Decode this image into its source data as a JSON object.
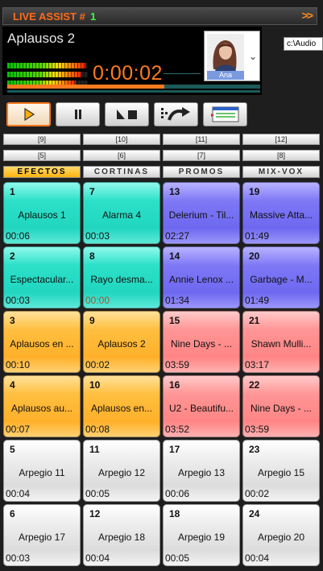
{
  "titlebar": {
    "title": "LIVE ASSIST #",
    "number": "1",
    "expand_icon": "double-chevron-right-icon",
    "title_color": "#ff6a1a",
    "number_color": "#32ff32"
  },
  "player": {
    "song_title": "Aplausos 2",
    "time": "0:00:02",
    "cover_label": "Ana",
    "path": "c:\\Audio",
    "progress_fraction": 0.62,
    "meter_levels": [
      0.97,
      0.92,
      0.85
    ],
    "accent_color": "#ff7a1f"
  },
  "transport": {
    "buttons": [
      {
        "name": "play-button",
        "icon": "play-icon"
      },
      {
        "name": "pause-button",
        "icon": "pause-icon"
      },
      {
        "name": "stop-button",
        "icon": "stop-icon"
      },
      {
        "name": "crossfade-button",
        "icon": "crossfade-icon"
      },
      {
        "name": "playlist-button",
        "icon": "playlist-icon"
      }
    ]
  },
  "tabs": {
    "row1": [
      "[9]",
      "[10]",
      "[11]",
      "[12]"
    ],
    "row2": [
      "[5]",
      "[6]",
      "[7]",
      "[8]"
    ],
    "categories": [
      "EFECTOS",
      "CORTINAS",
      "PROMOS",
      "MIX-VOX"
    ],
    "active_category": 0
  },
  "grid": [
    [
      {
        "num": "1",
        "name": "Aplausos 1",
        "time": "00:06",
        "color": "cyan"
      },
      {
        "num": "7",
        "name": "Alarma 4",
        "time": "00:03",
        "color": "cyan"
      },
      {
        "num": "13",
        "name": "Delerium - Til...",
        "time": "02:27",
        "color": "blue"
      },
      {
        "num": "19",
        "name": "Massive Atta...",
        "time": "01:49",
        "color": "blue"
      }
    ],
    [
      {
        "num": "2",
        "name": "Espectacular...",
        "time": "00:03",
        "color": "cyan"
      },
      {
        "num": "8",
        "name": "Rayo desma...",
        "time": "00:00",
        "color": "cyan",
        "time_color": "#9a5a3a"
      },
      {
        "num": "14",
        "name": "Annie Lenox ...",
        "time": "01:34",
        "color": "blue"
      },
      {
        "num": "20",
        "name": "Garbage - M...",
        "time": "01:49",
        "color": "blue"
      }
    ],
    [
      {
        "num": "3",
        "name": "Aplausos en ...",
        "time": "00:10",
        "color": "orange"
      },
      {
        "num": "9",
        "name": "Aplausos 2",
        "time": "00:02",
        "color": "orange"
      },
      {
        "num": "15",
        "name": "Nine Days - ...",
        "time": "03:59",
        "color": "red"
      },
      {
        "num": "21",
        "name": "Shawn Mulli...",
        "time": "03:17",
        "color": "red"
      }
    ],
    [
      {
        "num": "4",
        "name": "Aplausos au...",
        "time": "00:07",
        "color": "orange"
      },
      {
        "num": "10",
        "name": "Aplausos en...",
        "time": "00:08",
        "color": "orange"
      },
      {
        "num": "16",
        "name": "U2 - Beautifu...",
        "time": "03:52",
        "color": "red"
      },
      {
        "num": "22",
        "name": "Nine Days - ...",
        "time": "03:59",
        "color": "red"
      }
    ],
    [
      {
        "num": "5",
        "name": "Arpegio 11",
        "time": "00:04",
        "color": "gray"
      },
      {
        "num": "11",
        "name": "Arpegio 12",
        "time": "00:05",
        "color": "gray"
      },
      {
        "num": "17",
        "name": "Arpegio 13",
        "time": "00:06",
        "color": "gray"
      },
      {
        "num": "23",
        "name": "Arpegio 15",
        "time": "00:02",
        "color": "gray"
      }
    ],
    [
      {
        "num": "6",
        "name": "Arpegio 17",
        "time": "00:03",
        "color": "gray"
      },
      {
        "num": "12",
        "name": "Arpegio 18",
        "time": "00:04",
        "color": "gray"
      },
      {
        "num": "18",
        "name": "Arpegio 19",
        "time": "00:05",
        "color": "gray"
      },
      {
        "num": "24",
        "name": "Arpegio 20",
        "time": "00:04",
        "color": "gray"
      }
    ]
  ]
}
